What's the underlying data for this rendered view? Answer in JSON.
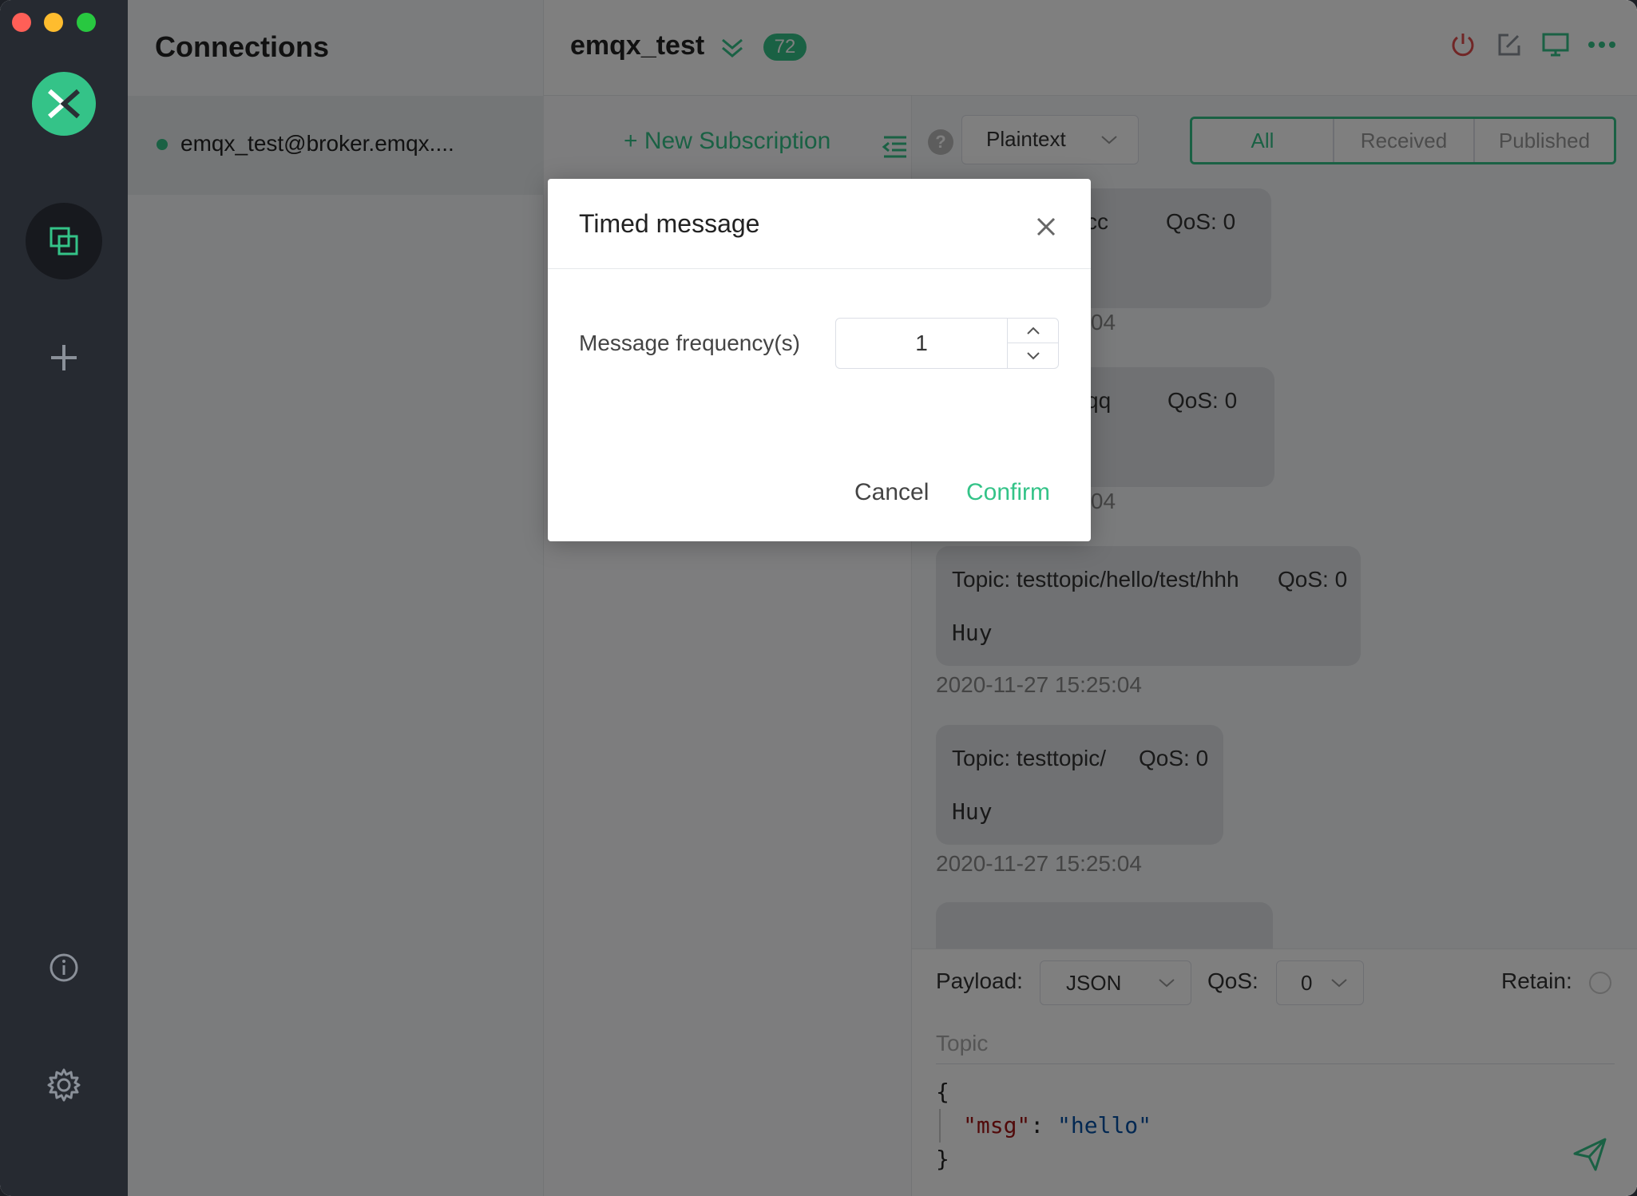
{
  "app": {
    "accent": "#34c388"
  },
  "sidebar": {
    "logo_icon": "mqttx-logo-icon",
    "items": [
      {
        "icon": "connections-icon",
        "active": true
      },
      {
        "icon": "plus-icon",
        "active": false
      },
      {
        "icon": "info-icon",
        "active": false
      },
      {
        "icon": "gear-icon",
        "active": false
      }
    ]
  },
  "connections": {
    "title": "Connections",
    "items": [
      {
        "name": "emqx_test@broker.emqx....",
        "status": "connected"
      }
    ]
  },
  "header": {
    "title": "emqx_test",
    "badge": "72",
    "icons": [
      "power-icon",
      "edit-icon",
      "monitor-icon",
      "more-icon"
    ]
  },
  "subscriptions": {
    "new_label": "+ New Subscription"
  },
  "messages": {
    "format": "Plaintext",
    "filters": [
      "All",
      "Received",
      "Published"
    ],
    "selected_filter": "All",
    "list": [
      {
        "topic": "ic/cc",
        "qos": "QoS: 0",
        "payload": "",
        "time": "25:04"
      },
      {
        "topic": "ic/qq",
        "qos": "QoS: 0",
        "payload": "",
        "time": "25:04"
      },
      {
        "topic": "Topic: testtopic/hello/test/hhh",
        "qos": "QoS: 0",
        "payload": "Huy",
        "time": "2020-11-27 15:25:04"
      },
      {
        "topic": "Topic: testtopic/",
        "qos": "QoS: 0",
        "payload": "Huy",
        "time": "2020-11-27 15:25:04"
      }
    ]
  },
  "publish": {
    "payload_label": "Payload:",
    "payload_format": "JSON",
    "qos_label": "QoS:",
    "qos_value": "0",
    "retain_label": "Retain:",
    "topic_placeholder": "Topic",
    "code": {
      "open": "{",
      "key": "\"msg\"",
      "colon": ": ",
      "value": "\"hello\"",
      "close": "}"
    }
  },
  "dialog": {
    "title": "Timed message",
    "field_label": "Message frequency(s)",
    "field_value": "1",
    "cancel": "Cancel",
    "confirm": "Confirm"
  }
}
